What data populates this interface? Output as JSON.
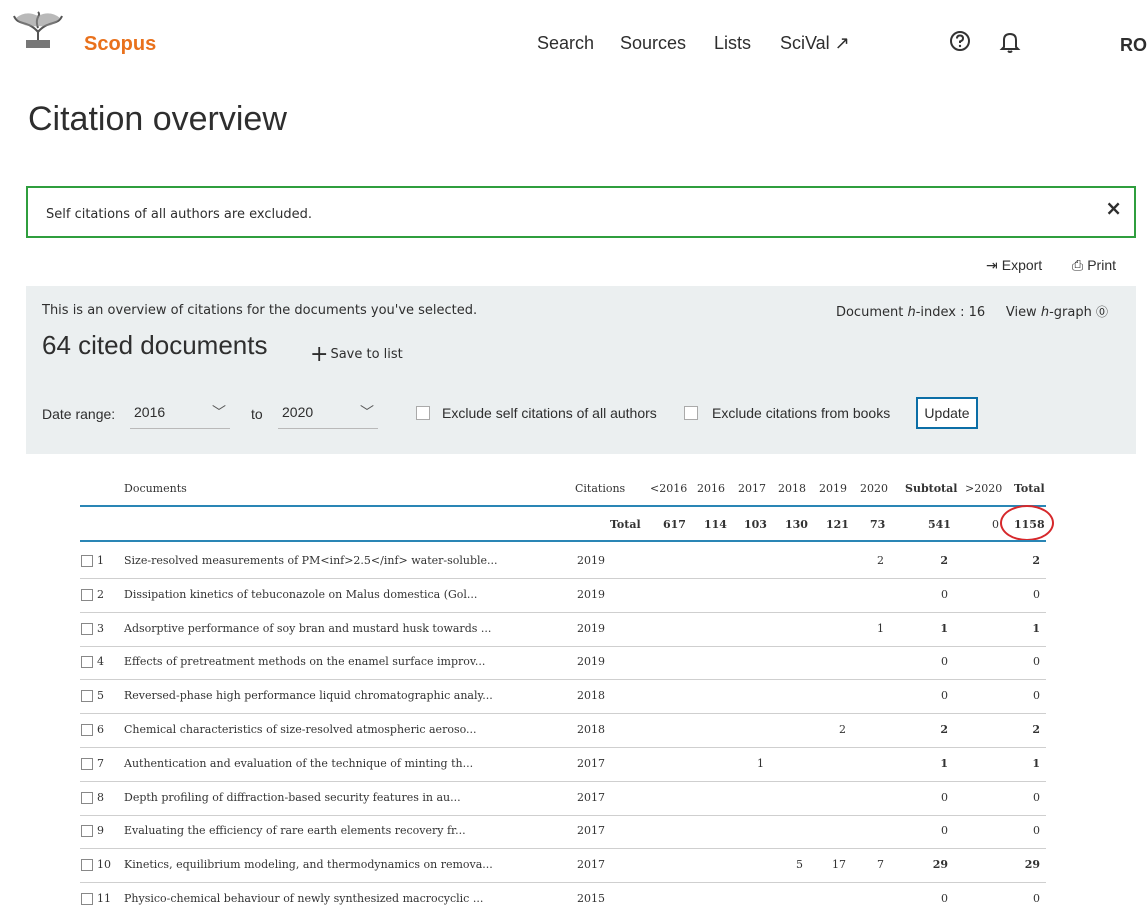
{
  "header": {
    "brand": "Scopus",
    "nav": [
      "Search",
      "Sources",
      "Lists",
      "SciVal ↗"
    ],
    "user_initials": "RO"
  },
  "page_title": "Citation overview",
  "notice": {
    "text": "Self citations of all authors are excluded.",
    "close": "×"
  },
  "actions": {
    "export": "Export",
    "print": "Print"
  },
  "panel": {
    "intro": "This is an overview of citations for the documents you've selected.",
    "hindex_label": "Document",
    "hindex_h": "h",
    "hindex_rest": "-index : 16",
    "view_label": "View",
    "view_h": "h",
    "view_rest": "-graph",
    "cited": "64 cited documents",
    "save_to_list": "Save to list",
    "date_range_label": "Date range:",
    "from_year": "2016",
    "to_label": "to",
    "to_year": "2020",
    "exclude_self": "Exclude self citations of all authors",
    "exclude_books": "Exclude citations from books",
    "update": "Update"
  },
  "table": {
    "headers": [
      "Documents",
      "Citations",
      "<2016",
      "2016",
      "2017",
      "2018",
      "2019",
      "2020",
      "Subtotal",
      ">2020",
      "Total"
    ],
    "totals": {
      "label": "Total",
      "values": [
        "617",
        "114",
        "103",
        "130",
        "121",
        "73",
        "541",
        "0",
        "1158"
      ]
    },
    "rows": [
      {
        "n": "1",
        "title": "Size-resolved measurements of PM<inf>2.5</inf> water-soluble...",
        "year": "2019",
        "c2018": "",
        "c2019": "",
        "c2020": "2",
        "c2017": "",
        "subtotal": "2",
        "total": "2"
      },
      {
        "n": "2",
        "title": "Dissipation kinetics of tebuconazole on Malus domestica (Gol...",
        "year": "2019",
        "c2017": "",
        "c2018": "",
        "c2019": "",
        "c2020": "",
        "subtotal": "0",
        "total": "0"
      },
      {
        "n": "3",
        "title": "Adsorptive performance of soy bran and mustard husk towards ...",
        "year": "2019",
        "c2017": "",
        "c2018": "",
        "c2019": "",
        "c2020": "1",
        "subtotal": "1",
        "total": "1"
      },
      {
        "n": "4",
        "title": "Effects of pretreatment methods on the enamel surface improv...",
        "year": "2019",
        "c2017": "",
        "c2018": "",
        "c2019": "",
        "c2020": "",
        "subtotal": "0",
        "total": "0"
      },
      {
        "n": "5",
        "title": "Reversed-phase high performance liquid chromatographic analy...",
        "year": "2018",
        "c2017": "",
        "c2018": "",
        "c2019": "",
        "c2020": "",
        "subtotal": "0",
        "total": "0"
      },
      {
        "n": "6",
        "title": "Chemical characteristics of size-resolved atmospheric aeroso...",
        "year": "2018",
        "c2017": "",
        "c2018": "",
        "c2019": "2",
        "c2020": "",
        "subtotal": "2",
        "total": "2"
      },
      {
        "n": "7",
        "title": "Authentication and evaluation of the technique of minting th...",
        "year": "2017",
        "c2017": "1",
        "c2018": "",
        "c2019": "",
        "c2020": "",
        "subtotal": "1",
        "total": "1"
      },
      {
        "n": "8",
        "title": "Depth profiling of diffraction-based security features in au...",
        "year": "2017",
        "c2017": "",
        "c2018": "",
        "c2019": "",
        "c2020": "",
        "subtotal": "0",
        "total": "0"
      },
      {
        "n": "9",
        "title": "Evaluating the efficiency of rare earth elements recovery fr...",
        "year": "2017",
        "c2017": "",
        "c2018": "",
        "c2019": "",
        "c2020": "",
        "subtotal": "0",
        "total": "0"
      },
      {
        "n": "10",
        "title": "Kinetics, equilibrium modeling, and thermodynamics on remova...",
        "year": "2017",
        "c2017": "",
        "c2018": "5",
        "c2019": "17",
        "c2020": "7",
        "subtotal": "29",
        "total": "29"
      },
      {
        "n": "11",
        "title": "Physico-chemical behaviour of newly synthesized macrocyclic ...",
        "year": "2015",
        "c2017": "",
        "c2018": "",
        "c2019": "",
        "c2020": "",
        "subtotal": "0",
        "total": "0"
      }
    ]
  },
  "colors": {
    "brand": "#e9711c",
    "notice_border": "#2f9e3e",
    "update_border": "#0b6ea6",
    "table_rule": "#2a86b5",
    "highlight_circle": "#d6282b"
  }
}
